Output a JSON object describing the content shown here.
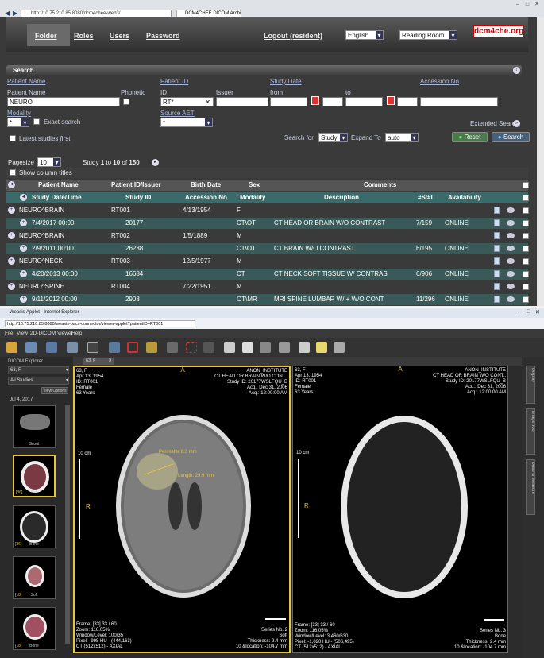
{
  "browser1": {
    "url": "http://10.75.210.85:8080/dcm4chee-web3/",
    "tab_title": "DCM4CHEE DICOM Archive",
    "nav": {
      "folder": "Folder",
      "roles": "Roles",
      "users": "Users",
      "password": "Password",
      "logout": "Logout (resident)"
    },
    "language": "English",
    "room": "Reading Room",
    "logo": "dcm4che.org",
    "search": {
      "title": "Search",
      "patient_name_link": "Patient Name",
      "patient_id_link": "Patient ID",
      "study_date_link": "Study Date",
      "accession_link": "Accession No",
      "patient_name_label": "Patient Name",
      "patient_name_value": "NEURO",
      "phonetic_label": "Phonetic",
      "id_label": "ID",
      "id_value": "RT*",
      "issuer_label": "Issuer",
      "from_label": "from",
      "to_label": "to",
      "modality_label": "Modality",
      "modality_value": "*",
      "exact_label": "Exact search",
      "source_aet_label": "Source AET",
      "source_aet_value": "*",
      "extended_label": "Extended Search",
      "latest_label": "Latest studies first",
      "search_for_label": "Search for",
      "search_for_value": "Study",
      "expand_label": "Expand To",
      "expand_value": "auto",
      "reset_label": "Reset",
      "search_label": "Search"
    },
    "paging": {
      "pagesize_label": "Pagesize",
      "pagesize_value": "10",
      "study_label": "Study",
      "from": "1",
      "to_label": "to",
      "to": "10",
      "of_label": "of",
      "total": "150"
    },
    "show_columns_label": "Show column titles",
    "patient_cols": {
      "name": "Patient Name",
      "id": "Patient ID/Issuer",
      "birth": "Birth Date",
      "sex": "Sex",
      "comments": "Comments"
    },
    "study_cols": {
      "date": "Study Date/Time",
      "id": "Study ID",
      "acc": "Accession No",
      "mod": "Modality",
      "desc": "Description",
      "count": "#S/#I",
      "avail": "Availability"
    },
    "records": [
      {
        "name": "NEURO^BRAIN",
        "pid": "RT001",
        "birth": "4/13/1954",
        "sex": "F",
        "date": "7/4/2017 00:00",
        "sid": "20177",
        "mod": "CT\\OT",
        "desc": "CT HEAD OR BRAIN W/O CONTRAST",
        "count": "7/159",
        "avail": "ONLINE"
      },
      {
        "name": "NEURO^BRAIN",
        "pid": "RT002",
        "birth": "1/5/1889",
        "sex": "M",
        "date": "2/9/2011 00:00",
        "sid": "26238",
        "mod": "CT\\OT",
        "desc": "CT BRAIN W/O CONTRAST",
        "count": "6/195",
        "avail": "ONLINE"
      },
      {
        "name": "NEURO^NECK",
        "pid": "RT003",
        "birth": "12/5/1977",
        "sex": "M",
        "date": "4/20/2013 00:00",
        "sid": "16684",
        "mod": "CT",
        "desc": "CT NECK SOFT TISSUE W/ CONTRAS",
        "count": "6/906",
        "avail": "ONLINE"
      },
      {
        "name": "NEURO^SPINE",
        "pid": "RT004",
        "birth": "7/22/1951",
        "sex": "M",
        "date": "9/11/2012 00:00",
        "sid": "2908",
        "mod": "OT\\MR",
        "desc": "MRI SPINE LUMBAR W/ + W/O CONT",
        "count": "11/296",
        "avail": "ONLINE"
      }
    ]
  },
  "browser2": {
    "title": "Weasis Applet - Internet Explorer",
    "url": "http://10.75.210.85:8080/weasis-pacs-connector/viewer-applet?patientID=RT001",
    "menu": [
      "File",
      "View",
      "2D-DICOM Viewer",
      "Help"
    ],
    "tab": "63, F",
    "explorer_title": "DICOM Explorer",
    "patient_select": "63, F",
    "studies_select": "All Studies",
    "view_options": "View Options",
    "study_date": "Jul 4, 2017",
    "thumbs": [
      {
        "label": "Scout",
        "count": ""
      },
      {
        "label": "Soft",
        "count": "[36]"
      },
      {
        "label": "Bone",
        "count": "[36]"
      },
      {
        "label": "Soft",
        "count": "[18]"
      },
      {
        "label": "Bone",
        "count": "[18]"
      }
    ],
    "side_tabs": [
      "Display",
      "Image Tool",
      "Draw & Measure"
    ],
    "viewports": [
      {
        "tl": [
          "63, F",
          "Apr 13, 1954",
          "ID: RT001",
          "Female",
          "63 Years"
        ],
        "tr": [
          "ANON_INSTITUTE",
          "CT HEAD OR BRAIN W/O CONT..",
          "Study ID: 20177WSLFQU_B",
          "Acq.: Dec 31, 2006",
          "Acq.: 12:00:00 AM"
        ],
        "bl": [
          "Frame: [33] 33 / 60",
          "Zoom: 116.05%",
          "Window/Level: 100/35",
          "Pixel: -998 HU - (444,163)",
          "CT (512x512) - AXIAL"
        ],
        "br": [
          "Series Nb. 2",
          "Soft",
          "Thickness: 2.4 mm",
          "10 &location: -104.7 mm"
        ],
        "top": "A",
        "left": "R",
        "scale": "10 cm",
        "measure1": "Perimeter 8.3 mm",
        "measure2": "Length: 29.9 mm"
      },
      {
        "tl": [
          "63, F",
          "Apr 13, 1954",
          "ID: RT001",
          "Female",
          "63 Years"
        ],
        "tr": [
          "ANON_INSTITUTE",
          "CT HEAD OR BRAIN W/O CONT..",
          "Study ID: 20177WSLFQU_B",
          "Acq.: Dec 31, 2006",
          "Acq.: 12:00:00 AM"
        ],
        "bl": [
          "Frame: [33] 33 / 60",
          "Zoom: 116.05%",
          "Window/Level: 3,460/630",
          "Pixel: -1,020 HU - (506,495)",
          "CT (512x512) - AXIAL"
        ],
        "br": [
          "Series Nb. 3",
          "Bone",
          "Thickness: 2.4 mm",
          "10 &location: -104.7 mm"
        ],
        "top": "A",
        "left": "R",
        "scale": "10 cm"
      }
    ]
  }
}
